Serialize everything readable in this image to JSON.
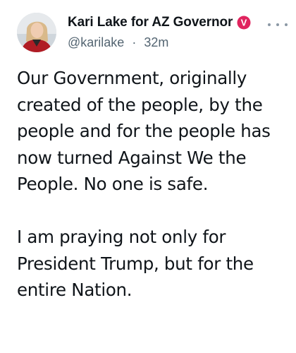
{
  "tweet": {
    "author": {
      "display_name": "Kari Lake for AZ Governor",
      "handle": "@karilake",
      "verified_badge_letter": "V",
      "verified_color": "#e0245e"
    },
    "separator": "·",
    "time_ago": "32m",
    "more_icon": "more-horizontal-icon",
    "paragraphs": [
      "Our Government, originally created of the people, by the people and for the people has now turned Against We the People. No one is safe.",
      "I am praying not only for President Trump, but for the entire Nation."
    ]
  }
}
